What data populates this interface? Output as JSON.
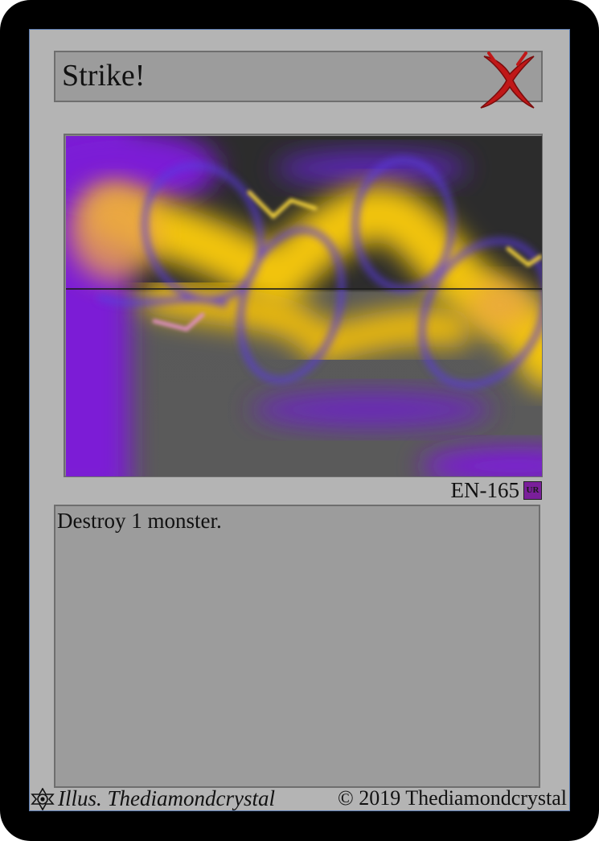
{
  "card": {
    "title": "Strike!",
    "type_icon": "red-x-icon",
    "set_code": "EN-165",
    "rarity": "UR",
    "effect_text": "Destroy 1 monster.",
    "illustrator": "Illus. Thediamondcrystal",
    "copyright": "© 2019 Thediamondcrystal",
    "illustrator_icon": "gear-eye-icon"
  },
  "colors": {
    "card_border": "#000000",
    "card_face": "#b4b4b4",
    "panel": "#9c9c9c",
    "type_icon": "#c01818",
    "rarity_badge": "#7a1f9a",
    "art_purple": "#7b1fd6",
    "art_yellow": "#f2c40a"
  }
}
